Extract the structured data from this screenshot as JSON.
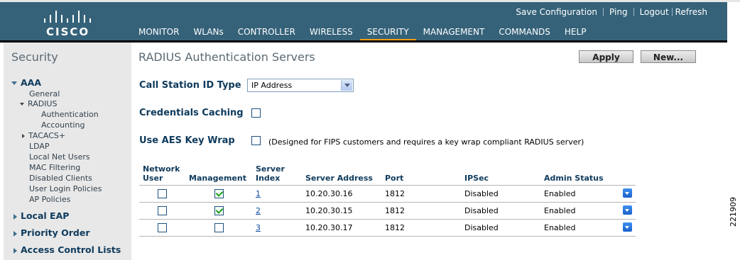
{
  "brand": {
    "logo_text": "CISCO"
  },
  "utility_links": [
    "Save Configuration",
    "Ping",
    "Logout",
    "Refresh"
  ],
  "nav": {
    "items": [
      "MONITOR",
      "WLANs",
      "CONTROLLER",
      "WIRELESS",
      "SECURITY",
      "MANAGEMENT",
      "COMMANDS",
      "HELP"
    ],
    "active": "SECURITY",
    "active_color": "#f39c12"
  },
  "sidebar": {
    "title": "Security",
    "aaa": "AAA",
    "general": "General",
    "radius": "RADIUS",
    "authentication": "Authentication",
    "accounting": "Accounting",
    "tacacs": "TACACS+",
    "ldap": "LDAP",
    "local_net_users": "Local Net Users",
    "mac_filtering": "MAC Filtering",
    "disabled_clients": "Disabled Clients",
    "user_login_policies": "User Login Policies",
    "ap_policies": "AP Policies",
    "local_eap": "Local EAP",
    "priority_order": "Priority Order",
    "access_control_lists": "Access Control Lists"
  },
  "page": {
    "title": "RADIUS Authentication Servers",
    "apply_label": "Apply",
    "new_label": "New..."
  },
  "form": {
    "call_station_label": "Call Station ID Type",
    "call_station_value": "IP Address",
    "credentials_caching_label": "Credentials Caching",
    "credentials_caching_checked": false,
    "aes_key_wrap_label": "Use AES Key Wrap",
    "aes_key_wrap_checked": false,
    "aes_note": "(Designed for FIPS customers and requires a key wrap compliant RADIUS server)"
  },
  "table": {
    "headers": {
      "network_user_1": "Network",
      "network_user_2": "User",
      "management": "Management",
      "server_index_1": "Server",
      "server_index_2": "Index",
      "server_address": "Server Address",
      "port": "Port",
      "ipsec": "IPSec",
      "admin_status": "Admin Status"
    },
    "rows": [
      {
        "network_user": false,
        "management": true,
        "index": "1",
        "address": "10.20.30.16",
        "port": "1812",
        "ipsec": "Disabled",
        "status": "Enabled"
      },
      {
        "network_user": false,
        "management": true,
        "index": "2",
        "address": "10.20.30.15",
        "port": "1812",
        "ipsec": "Disabled",
        "status": "Enabled"
      },
      {
        "network_user": false,
        "management": false,
        "index": "3",
        "address": "10.20.30.17",
        "port": "1812",
        "ipsec": "Disabled",
        "status": "Enabled"
      }
    ]
  },
  "figure_number": "221909"
}
